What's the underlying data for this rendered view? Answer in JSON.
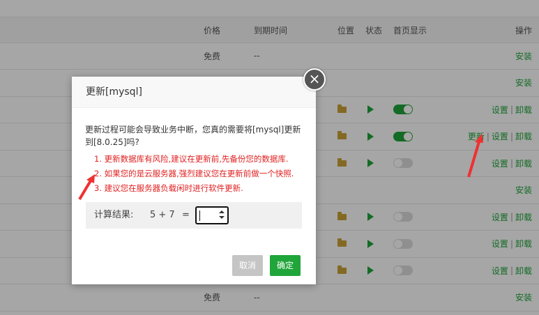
{
  "header": {
    "price": "价格",
    "expire": "到期时间",
    "position": "位置",
    "state": "状态",
    "homepage": "首页显示",
    "ops": "操作"
  },
  "rows": [
    {
      "price": "免费",
      "expire": "--",
      "folder": false,
      "play": false,
      "toggle": null,
      "ops": [
        "安装"
      ]
    },
    {
      "price": "",
      "expire": "",
      "folder": false,
      "play": false,
      "toggle": null,
      "ops": [
        "安装"
      ]
    },
    {
      "price": "",
      "expire": "",
      "folder": true,
      "play": true,
      "toggle": "on",
      "ops": [
        "设置",
        "卸载"
      ]
    },
    {
      "price": "",
      "expire": "",
      "folder": true,
      "play": true,
      "toggle": "on",
      "ops": [
        "更新",
        "设置",
        "卸载"
      ]
    },
    {
      "price": "",
      "expire": "",
      "folder": true,
      "play": true,
      "toggle": "off",
      "ops": [
        "设置",
        "卸载"
      ]
    },
    {
      "price": "",
      "expire": "",
      "folder": false,
      "play": false,
      "toggle": null,
      "ops": [
        "安装"
      ]
    },
    {
      "price": "",
      "expire": "",
      "folder": true,
      "play": true,
      "toggle": "off",
      "ops": [
        "设置",
        "卸载"
      ]
    },
    {
      "price": "",
      "expire": "",
      "folder": true,
      "play": true,
      "toggle": "off",
      "ops": [
        "设置",
        "卸载"
      ]
    },
    {
      "price": "",
      "expire": "",
      "folder": true,
      "play": true,
      "toggle": "off",
      "ops": [
        "设置",
        "卸载"
      ]
    },
    {
      "price": "免费",
      "expire": "--",
      "folder": false,
      "play": false,
      "toggle": null,
      "ops": [
        "安装"
      ]
    }
  ],
  "dialog": {
    "title": "更新[mysql]",
    "close_icon": "×",
    "message": "更新过程可能会导致业务中断，您真的需要将[mysql]更新到[8.0.25]吗?",
    "warnings": [
      "1. 更新数据库有风险,建议在更新前,先备份您的数据库.",
      "2. 如果您的是云服务器,强烈建议您在更新前做一个快照.",
      "3. 建议您在服务器负载闲时进行软件更新."
    ],
    "calc_label": "计算结果:",
    "calc_expr": "5 + 7",
    "calc_eq": "=",
    "calc_value": "",
    "cancel_label": "取消",
    "ok_label": "确定"
  },
  "colors": {
    "accent": "#20a53a",
    "warning": "#e02020",
    "annotation_arrow": "#f03030"
  }
}
